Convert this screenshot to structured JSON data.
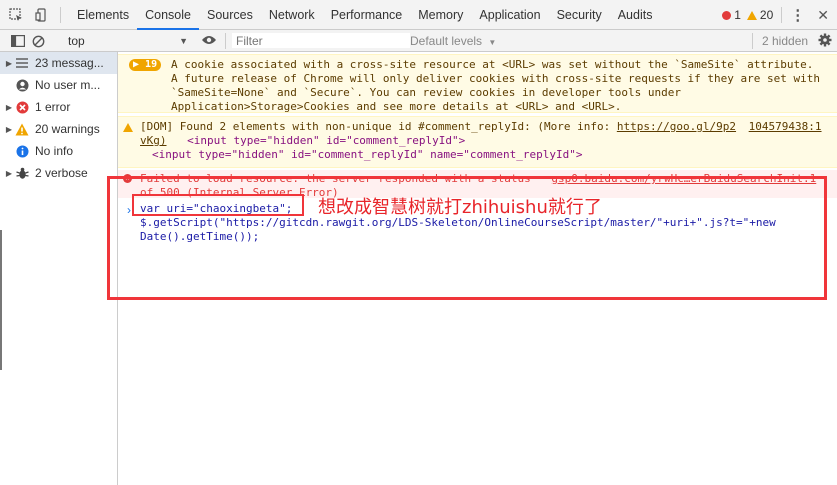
{
  "tabs": {
    "items": [
      "Elements",
      "Console",
      "Sources",
      "Network",
      "Performance",
      "Memory",
      "Application",
      "Security",
      "Audits"
    ],
    "error_count": "1",
    "warning_count": "20"
  },
  "toolbar": {
    "context": "top",
    "filter_placeholder": "Filter",
    "levels": "Default levels",
    "hidden": "2 hidden"
  },
  "sidebar": {
    "items": [
      {
        "label": "23 messag...",
        "icon": "list-icon"
      },
      {
        "label": "No user m...",
        "icon": "user-icon"
      },
      {
        "label": "1 error",
        "icon": "error-icon"
      },
      {
        "label": "20 warnings",
        "icon": "warning-icon"
      },
      {
        "label": "No info",
        "icon": "info-icon"
      },
      {
        "label": "2 verbose",
        "icon": "bug-icon"
      }
    ]
  },
  "console": {
    "samesite_warning": {
      "count": "19",
      "lines": [
        "A cookie associated with a cross-site resource at <URL> was set without the `SameSite` attribute.",
        "A future release of Chrome will only deliver cookies with cross-site requests if they are set with",
        "`SameSite=None` and `Secure`. You can review cookies in developer tools under",
        "Application>Storage>Cookies and see more details at <URL> and <URL>."
      ]
    },
    "dom_warning": {
      "text": "[DOM] Found 2 elements with non-unique id #comment_replyId: (More info: ",
      "link": "https://goo.gl/9p2",
      "source": "104579438:1",
      "vkg": "vKg)",
      "line1_tag": "<input type=\"hidden\" id=\"comment_replyId\">",
      "line2_tag": "<input type=\"hidden\" id=\"comment_replyId\" name=\"comment_replyId\">"
    },
    "error": {
      "text": "Failed to load resource: the server responded with a status",
      "source": "gsp0.baidu.com/yrwHc…erBaiduSearchInit:1",
      "line2": "of 500 (Internal Server Error)"
    },
    "input_code": {
      "line1": "var uri=\"chaoxingbeta\";",
      "line2": "$.getScript(\"https://gitcdn.rawgit.org/LDS-Skeleton/OnlineCourseScript/master/\"+uri+\".js?t=\"+new",
      "line3": "Date().getTime());"
    }
  },
  "annotation": {
    "note": "想改成智慧树就打zhihuishu就行了"
  },
  "colors": {
    "accent": "#1a73e8",
    "warning": "#f0a500",
    "error": "#e23b3b",
    "annotation": "#f0353a"
  }
}
